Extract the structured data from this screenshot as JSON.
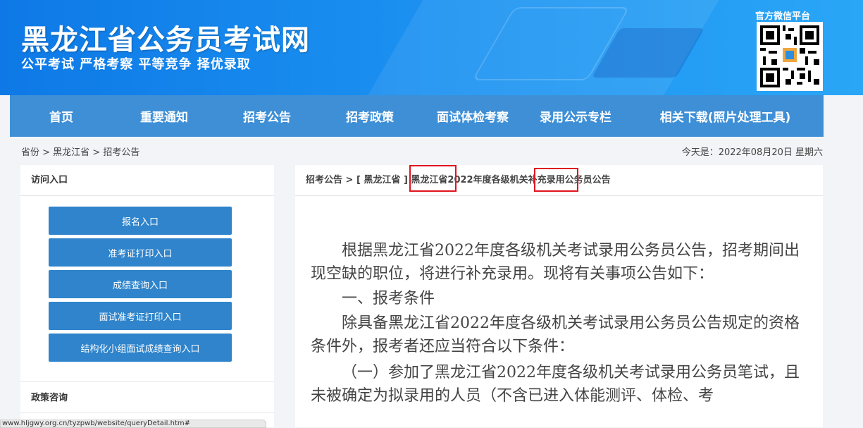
{
  "header": {
    "title": "黑龙江省公务员考试网",
    "slogan": "公平考试 严格考察 平等竞争 择优录取",
    "qr_label": "官方微信平台"
  },
  "nav": {
    "items": [
      {
        "label": "首页"
      },
      {
        "label": "重要通知"
      },
      {
        "label": "招考公告"
      },
      {
        "label": "招考政策"
      },
      {
        "label": "面试体检考察"
      },
      {
        "label": "录用公示专栏"
      },
      {
        "label": "相关下载(照片处理工具)"
      }
    ]
  },
  "breadcrumb": "省份 > 黑龙江省 > 招考公告",
  "date": "今天是：2022年08月20日 星期六",
  "sidebar": {
    "section1_title": "访问入口",
    "buttons": [
      {
        "label": "报名入口"
      },
      {
        "label": "准考证打印入口"
      },
      {
        "label": "成绩查询入口"
      },
      {
        "label": "面试准考证打印入口"
      },
      {
        "label": "结构化小组面试成绩查询入口"
      }
    ],
    "section2_title": "政策咨询"
  },
  "article": {
    "path": "招考公告 > [ 黑龙江省 ] 黑龙江省2022年度各级机关补充录用公务员公告",
    "paragraphs": [
      "根据黑龙江省2022年度各级机关考试录用公务员公告，招考期间出现空缺的职位，将进行补充录用。现将有关事项公告如下：",
      "一、报考条件",
      "除具备黑龙江省2022年度各级机关考试录用公务员公告规定的资格条件外，报考者还应当符合以下条件：",
      "（一）参加了黑龙江省2022年度各级机关考试录用公务员笔试，且未被确定为拟录用的人员（不含已进入体能测评、体检、考"
    ]
  },
  "status_url": "www.hljgwy.org.cn/tyzpwb/website/queryDetail.htm#",
  "colors": {
    "header_blue": "#1a8ff0",
    "nav_blue": "#3e8fd6",
    "button_blue": "#2f84cb",
    "highlight_red": "#e0141e"
  }
}
